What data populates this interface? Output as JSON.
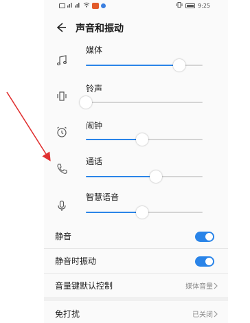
{
  "status_bar": {
    "left_text": "\"∂ \"∂",
    "right_vibrate": "│□│",
    "time": "9:25"
  },
  "header": {
    "title": "声音和振动",
    "back_icon": "arrow-left-icon"
  },
  "volumes": [
    {
      "label": "媒体",
      "icon": "music-note-icon",
      "level": 0.8
    },
    {
      "label": "铃声",
      "icon": "vibrate-phone-icon",
      "level": 0.0
    },
    {
      "label": "闹钟",
      "icon": "alarm-clock-icon",
      "level": 0.48
    },
    {
      "label": "通话",
      "icon": "phone-icon",
      "level": 0.6
    },
    {
      "label": "智慧语音",
      "icon": "microphone-icon",
      "level": 0.48
    }
  ],
  "settings": [
    {
      "label": "静音",
      "type": "toggle",
      "on": true
    },
    {
      "label": "静音时振动",
      "type": "toggle",
      "on": true
    },
    {
      "label": "音量键默认控制",
      "type": "link",
      "value": "媒体音量"
    }
  ],
  "second_group": [
    {
      "label": "免打扰",
      "type": "link",
      "value": "已关闭"
    }
  ],
  "colors": {
    "accent": "#2a84e8",
    "annotation_arrow": "#e03030",
    "background": "#fafafa"
  }
}
